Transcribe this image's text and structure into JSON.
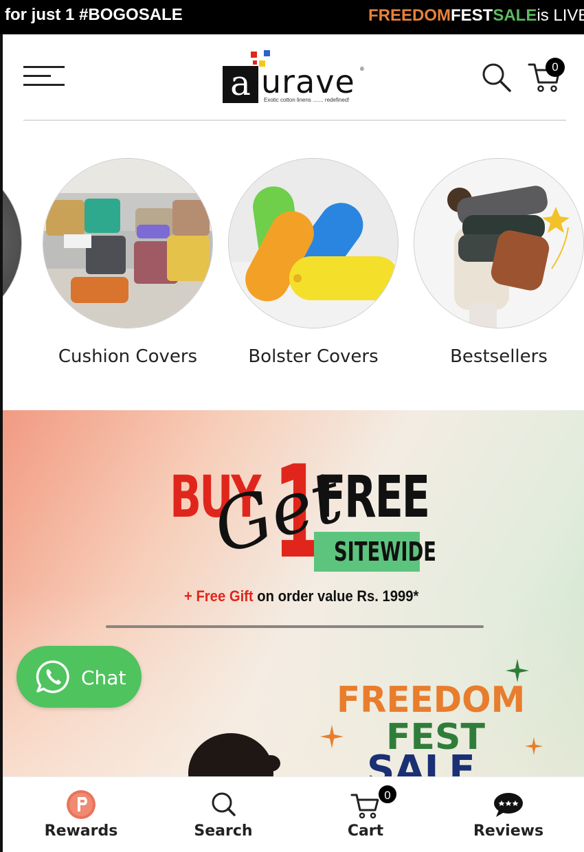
{
  "announcement": {
    "left_text": "for just 1 #BOGOSALE",
    "right_words": [
      "FREEDOM",
      "FEST",
      "SALE",
      "is LIVE"
    ],
    "right_colors": [
      "#e8813a",
      "#ffffff",
      "#5cba5f",
      "#ffffff"
    ]
  },
  "header": {
    "brand_letter": "a",
    "brand_word": "urave",
    "brand_tagline": "Exotic cotton linens ....... redefined!",
    "brand_registered": "®",
    "cart_count": "0"
  },
  "categories": [
    {
      "label": "Cushion Covers"
    },
    {
      "label": "Bolster Covers"
    },
    {
      "label": "Bestsellers"
    }
  ],
  "banner": {
    "buy": "BUY",
    "get": "Get",
    "one": "1",
    "free": "FREE",
    "sitewide": "SITEWIDE",
    "gift_highlight": "+ Free Gift",
    "gift_rest": " on order value Rs. 1999*",
    "fest_line1": "FREEDOM",
    "fest_line2": "FEST",
    "fest_line3": "SALE"
  },
  "chat": {
    "label": "Chat"
  },
  "bottom_nav": [
    {
      "label": "Rewards",
      "icon": "rewards-icon"
    },
    {
      "label": "Search",
      "icon": "search-icon"
    },
    {
      "label": "Cart",
      "icon": "cart-icon",
      "badge": "0"
    },
    {
      "label": "Reviews",
      "icon": "reviews-icon"
    }
  ],
  "colors": {
    "accent_red": "#e0261c",
    "chat_green": "#4fc35e",
    "sitewide_green": "#5dc47e",
    "fest_orange": "#e87d2d",
    "fest_green": "#2f7d3a",
    "fest_navy": "#1a2f74"
  }
}
